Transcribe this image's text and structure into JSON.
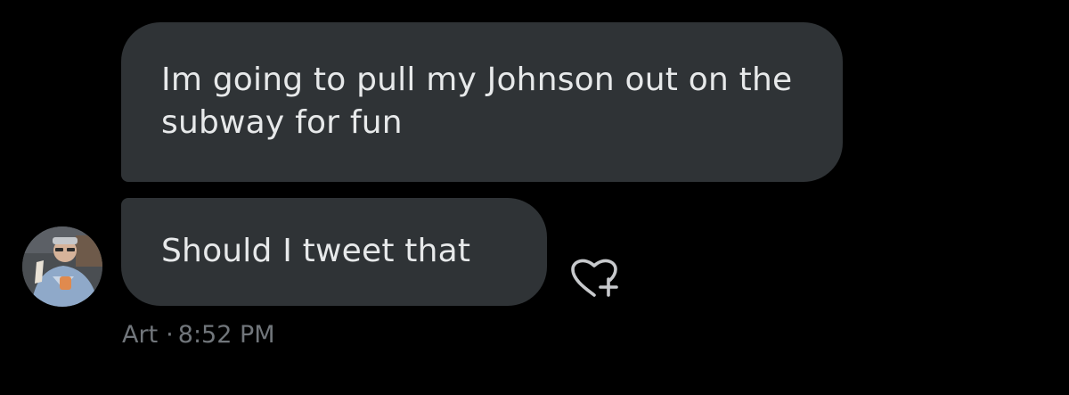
{
  "messages": [
    {
      "text": "Im going to pull my Johnson out on the subway for fun"
    },
    {
      "text": "Should I tweet that"
    }
  ],
  "sender": {
    "name": "Art",
    "separator": "·",
    "time": "8:52 PM",
    "avatar_icon": "user-avatar"
  },
  "reaction": {
    "icon": "heart-plus-icon"
  },
  "colors": {
    "background": "#000000",
    "bubble": "#2f3336",
    "text": "#e7e9ea",
    "meta": "#71767b"
  }
}
